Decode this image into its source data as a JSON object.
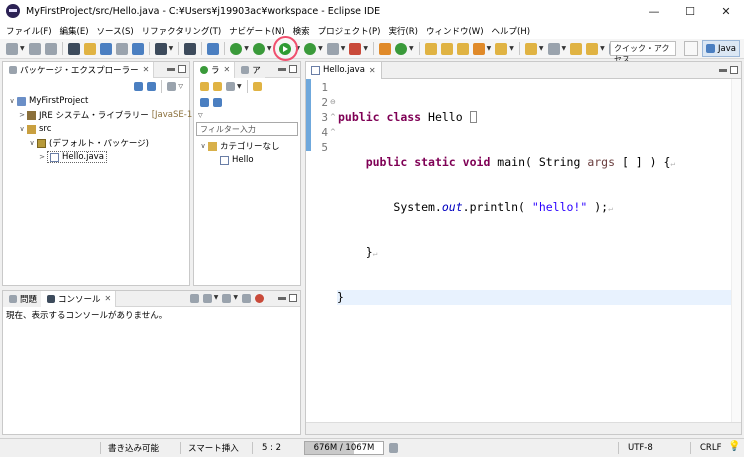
{
  "window": {
    "title": "MyFirstProject/src/Hello.java - C:¥Users¥j19903ac¥workspace - Eclipse IDE",
    "controls": {
      "minimize": "—",
      "maximize": "☐",
      "close": "✕"
    }
  },
  "menu": [
    "ファイル(F)",
    "編集(E)",
    "ソース(S)",
    "リファクタリング(T)",
    "ナビゲート(N)",
    "検索",
    "プロジェクト(P)",
    "実行(R)",
    "ウィンドウ(W)",
    "ヘルプ(H)"
  ],
  "toolbar": {
    "quick_access_placeholder": "クイック・アクセス",
    "perspective_label": "Java",
    "run_button_highlighted": true,
    "highlight_color": "#f0506e"
  },
  "package_explorer": {
    "tab_label": "パッケージ・エクスプローラー",
    "tree": {
      "project": "MyFirstProject",
      "jre": "JRE システム・ライブラリー",
      "jre_decoration": "[JavaSE-1.8]",
      "src": "src",
      "default_package": "(デフォルト・パッケージ)",
      "file": "Hello.java"
    }
  },
  "outline": {
    "tab_short_1": "ラ",
    "tab_short_2": "ア",
    "filter_placeholder": "フィルター入力",
    "category": "カテゴリーなし",
    "class_item": "Hello"
  },
  "editor": {
    "tab_label": "Hello.java",
    "line_numbers": [
      "1",
      "2",
      "3",
      "4",
      "5"
    ],
    "lines": {
      "l1_kw1": "public",
      "l1_kw2": "class",
      "l1_rest": " Hello ",
      "l2_kw1": "public",
      "l2_kw2": "static",
      "l2_kw3": "void",
      "l2_mid": " main( String ",
      "l2_param": "args",
      "l2_end": " [ ] ) {",
      "l3_pre": "System.",
      "l3_field": "out",
      "l3_mid": ".println( ",
      "l3_str": "\"hello!\"",
      "l3_end": " );",
      "l4": "}",
      "l5": "}",
      "ws_marker": "↵"
    }
  },
  "console": {
    "tab_problems": "問題",
    "tab_console": "コンソール",
    "message": "現在、表示するコンソールがありません。"
  },
  "status": {
    "writable": "書き込み可能",
    "insert_mode": "スマート挿入",
    "position": "5 : 2",
    "heap": "676M / 1067M",
    "heap_used_fraction": 0.63,
    "encoding": "UTF-8",
    "line_delimiter": "CRLF"
  }
}
